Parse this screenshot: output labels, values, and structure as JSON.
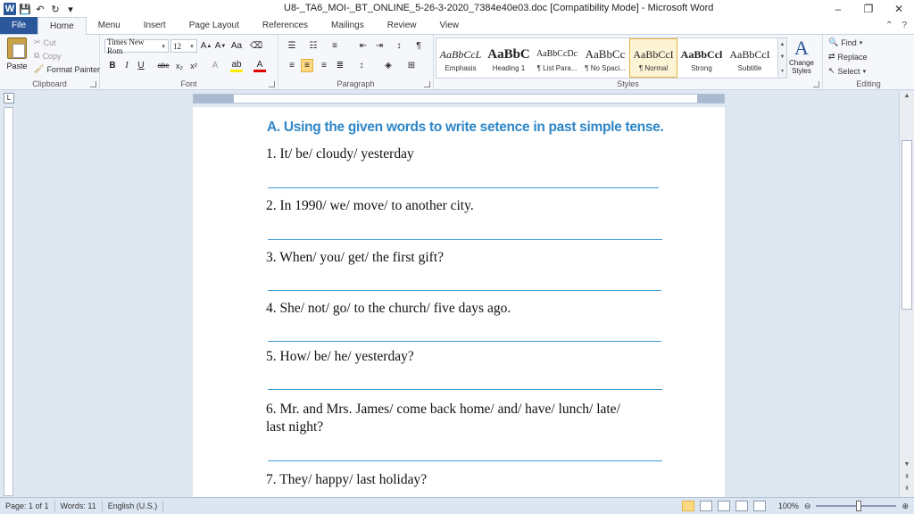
{
  "window": {
    "title": "U8-_TA6_MOI-_BT_ONLINE_5-26-3-2020_7384e40e03.doc [Compatibility Mode]  -  Microsoft Word",
    "minimize": "–",
    "restore": "❐",
    "close": "✕"
  },
  "tabs": [
    "File",
    "Home",
    "Menu",
    "Insert",
    "Page Layout",
    "References",
    "Mailings",
    "Review",
    "View"
  ],
  "clipboard": {
    "paste": "Paste",
    "cut": "Cut",
    "copy": "Copy",
    "format_painter": "Format Painter",
    "label": "Clipboard"
  },
  "font": {
    "name": "Times New Rom",
    "size": "12",
    "label": "Font"
  },
  "paragraph": {
    "label": "Paragraph"
  },
  "styles": {
    "items": [
      {
        "sample": "AaBbCcL",
        "name": "Emphasis"
      },
      {
        "sample": "AaBbC",
        "name": "Heading 1"
      },
      {
        "sample": "AaBbCcDc",
        "name": "¶ List Para..."
      },
      {
        "sample": "AaBbCc",
        "name": "¶ No Spaci..."
      },
      {
        "sample": "AaBbCcI",
        "name": "¶ Normal"
      },
      {
        "sample": "AaBbCcl",
        "name": "Strong"
      },
      {
        "sample": "AaBbCcI",
        "name": "Subtitle"
      }
    ],
    "change_styles": "Change Styles",
    "label": "Styles"
  },
  "editing": {
    "find": "Find",
    "replace": "Replace",
    "select": "Select",
    "label": "Editing"
  },
  "document": {
    "heading": "A. Using the given words to write setence in past simple tense.",
    "questions": [
      "1. It/ be/ cloudy/ yesterday",
      "2. In 1990/ we/ move/ to another city.",
      "3. When/ you/ get/ the first gift?",
      "4. She/ not/ go/ to the church/ five days ago.",
      "5. How/ be/ he/ yesterday?",
      "6. Mr. and Mrs. James/ come back home/ and/ have/ lunch/ late/",
      "last night?",
      "7. They/ happy/ last holiday?"
    ]
  },
  "status": {
    "page": "Page: 1 of 1",
    "words": "Words: 11",
    "language": "English (U.S.)",
    "zoom": "100%"
  }
}
